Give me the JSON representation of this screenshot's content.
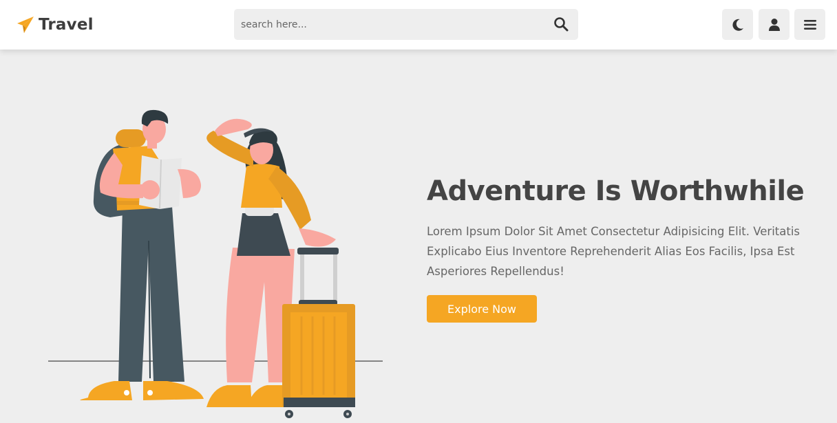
{
  "brand": {
    "name": "Travel",
    "icon": "paper-plane-icon",
    "accent": "#f5a623"
  },
  "search": {
    "placeholder": "search here...",
    "icon": "search-icon"
  },
  "header_buttons": [
    {
      "icon": "moon-icon"
    },
    {
      "icon": "user-icon"
    },
    {
      "icon": "menu-icon"
    }
  ],
  "hero": {
    "title": "Adventure Is Worthwhile",
    "description": "Lorem Ipsum Dolor Sit Amet Consectetur Adipisicing Elit. Veritatis Explicabo Eius Inventore Reprehenderit Alias Eos Facilis, Ipsa Est Asperiores Repellendus!",
    "button_label": "Explore Now",
    "illustration": "travelers-illustration"
  },
  "colors": {
    "background": "#eeeeee",
    "header": "#ffffff",
    "accent": "#f5a623",
    "text": "#444444"
  }
}
